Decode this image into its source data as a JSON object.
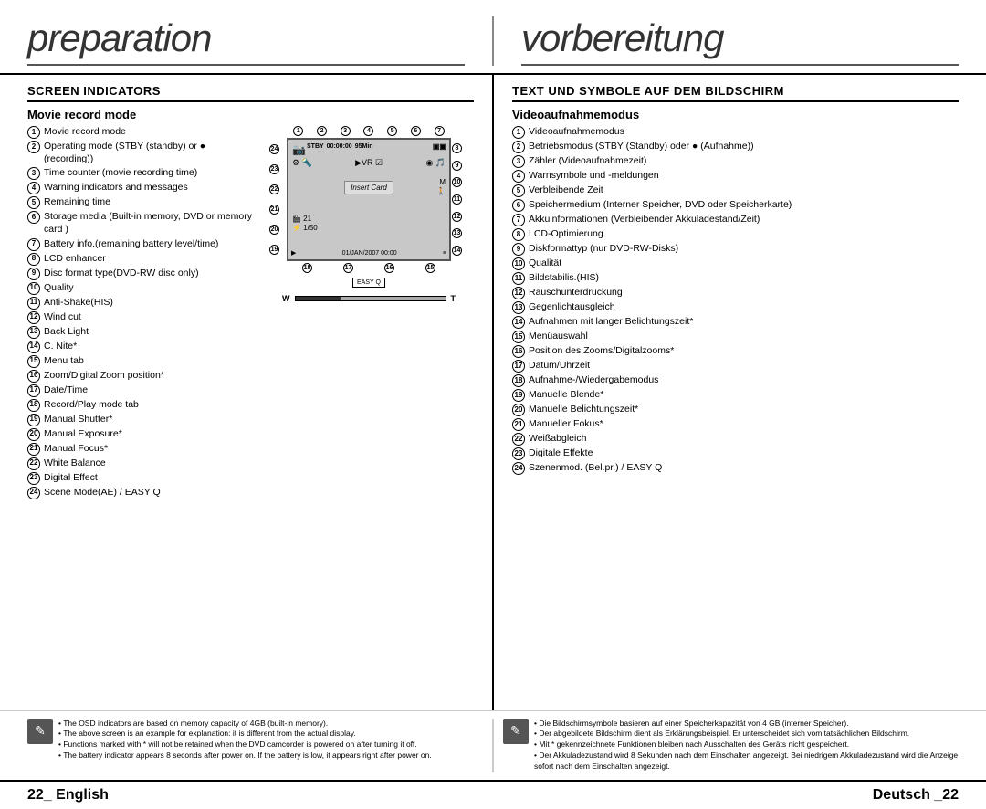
{
  "header": {
    "left_title": "preparation",
    "right_title": "vorbereitung"
  },
  "left_section": {
    "title": "SCREEN INDICATORS",
    "subsection": "Movie record mode",
    "items": [
      {
        "num": "1",
        "text": "Movie record mode"
      },
      {
        "num": "2",
        "text": "Operating mode (STBY (standby) or ● (recording))"
      },
      {
        "num": "3",
        "text": "Time counter (movie recording time)"
      },
      {
        "num": "4",
        "text": "Warning indicators and messages"
      },
      {
        "num": "5",
        "text": "Remaining time"
      },
      {
        "num": "6",
        "text": "Storage media (Built-in memory, DVD or memory card )"
      },
      {
        "num": "7",
        "text": "Battery info.(remaining battery level/time)"
      },
      {
        "num": "8",
        "text": "LCD enhancer"
      },
      {
        "num": "9",
        "text": "Disc format type(DVD-RW disc only)"
      },
      {
        "num": "10",
        "text": "Quality"
      },
      {
        "num": "11",
        "text": "Anti-Shake(HIS)"
      },
      {
        "num": "12",
        "text": "Wind cut"
      },
      {
        "num": "13",
        "text": "Back Light"
      },
      {
        "num": "14",
        "text": "C. Nite*"
      },
      {
        "num": "15",
        "text": "Menu tab"
      },
      {
        "num": "16",
        "text": "Zoom/Digital Zoom position*"
      },
      {
        "num": "17",
        "text": "Date/Time"
      },
      {
        "num": "18",
        "text": "Record/Play mode tab"
      },
      {
        "num": "19",
        "text": "Manual Shutter*"
      },
      {
        "num": "20",
        "text": "Manual Exposure*"
      },
      {
        "num": "21",
        "text": "Manual Focus*"
      },
      {
        "num": "22",
        "text": "White Balance"
      },
      {
        "num": "23",
        "text": "Digital Effect"
      },
      {
        "num": "24",
        "text": "Scene Mode(AE) / EASY Q"
      }
    ]
  },
  "right_section": {
    "title": "TEXT UND SYMBOLE AUF DEM BILDSCHIRM",
    "subsection": "Videoaufnahmemodus",
    "items": [
      {
        "num": "1",
        "text": "Videoaufnahmemodus"
      },
      {
        "num": "2",
        "text": "Betriebsmodus (STBY (Standby) oder ● (Aufnahme))"
      },
      {
        "num": "3",
        "text": "Zähler (Videoaufnahmezeit)"
      },
      {
        "num": "4",
        "text": "Warnsymbole und -meldungen"
      },
      {
        "num": "5",
        "text": "Verbleibende Zeit"
      },
      {
        "num": "6",
        "text": "Speichermedium (Interner Speicher, DVD oder Speicherkarte)"
      },
      {
        "num": "7",
        "text": "Akkuinformationen (Verbleibender Akkuladestand/Zeit)"
      },
      {
        "num": "8",
        "text": "LCD-Optimierung"
      },
      {
        "num": "9",
        "text": "Diskformattyp (nur DVD-RW-Disks)"
      },
      {
        "num": "10",
        "text": "Qualität"
      },
      {
        "num": "11",
        "text": "Bildstabilis.(HIS)"
      },
      {
        "num": "12",
        "text": "Rauschunterdrückung"
      },
      {
        "num": "13",
        "text": "Gegenlichtausgleich"
      },
      {
        "num": "14",
        "text": "Aufnahmen mit langer Belichtungszeit*"
      },
      {
        "num": "15",
        "text": "Menüauswahl"
      },
      {
        "num": "16",
        "text": "Position des Zooms/Digitalzooms*"
      },
      {
        "num": "17",
        "text": "Datum/Uhrzeit"
      },
      {
        "num": "18",
        "text": "Aufnahme-/Wiedergabemodus"
      },
      {
        "num": "19",
        "text": "Manuelle Blende*"
      },
      {
        "num": "20",
        "text": "Manuelle Belichtungszeit*"
      },
      {
        "num": "21",
        "text": "Manueller Fokus*"
      },
      {
        "num": "22",
        "text": "Weißabgleich"
      },
      {
        "num": "23",
        "text": "Digitale Effekte"
      },
      {
        "num": "24",
        "text": "Szenenmod. (Bel.pr.) / EASY Q"
      }
    ]
  },
  "camera_display": {
    "status_bar": "STBY 00:00:00 95Min",
    "date_bar": "01/JAN/2007 00:00",
    "insert_card": "Insert Card",
    "top_numbers": [
      "1",
      "2",
      "3",
      "4",
      "5",
      "6",
      "7"
    ],
    "right_numbers": [
      "8",
      "9",
      "10",
      "11",
      "12",
      "13",
      "14"
    ],
    "left_numbers": [
      "24",
      "23",
      "22",
      "21",
      "20",
      "19"
    ],
    "bottom_numbers": [
      "18",
      "17",
      "16",
      "15"
    ],
    "zoom_left": "W",
    "zoom_right": "T",
    "easy_q": "EASY Q"
  },
  "notes_left": {
    "bullets": [
      "The OSD indicators are based on memory capacity of 4GB (built-in memory).",
      "The above screen is an example for explanation: it is different from the actual display.",
      "Functions marked with * will not be retained when the DVD camcorder is powered on after turning it off.",
      "The battery indicator appears 8 seconds after power on. If the battery is low, it appears right after power on."
    ]
  },
  "notes_right": {
    "bullets": [
      "Die Bildschirmsymbole basieren auf einer Speicherkapazität von 4 GB (interner Speicher).",
      "Der abgebildete Bildschirm dient als Erklärungsbeispiel. Er unterscheidet sich vom tatsächlichen Bildschirm.",
      "Mit * gekennzeichnete Funktionen bleiben nach Ausschalten des Geräts nicht gespeichert.",
      "Der Akkuladezustand wird 8 Sekunden nach dem Einschalten angezeigt. Bei niedrigem Akkuladezustand wird die Anzeige sofort nach dem Einschalten angezeigt."
    ]
  },
  "footer": {
    "left": "22_  English",
    "right": "Deutsch _22"
  }
}
